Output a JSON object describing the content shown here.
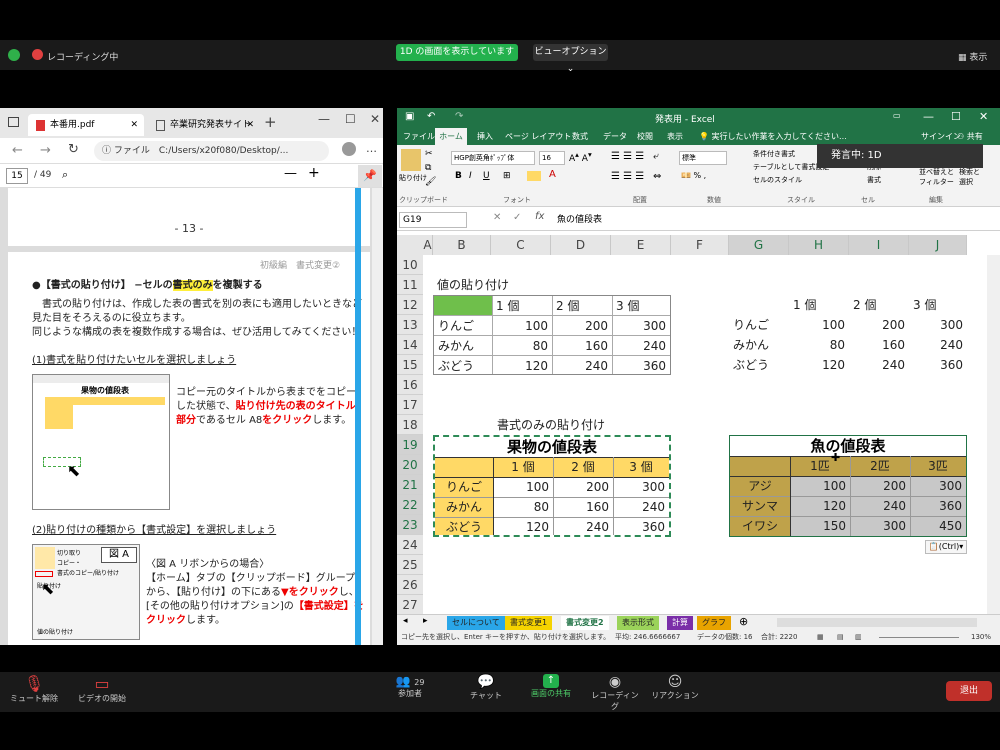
{
  "zoom_top": {
    "recording": "レコーディング中",
    "share_status": "1D の画面を表示しています",
    "view_options": "ビューオプション ⌄",
    "display": "表示"
  },
  "pdf": {
    "tabs": [
      "本番用.pdf",
      "卒業研究発表サイト"
    ],
    "address": "ファイル　C:/Users/x20f080/Desktop/...",
    "page_current": "15",
    "page_total": "/ 49",
    "page_number": "- 13 -",
    "header_right": "初級編　書式変更②",
    "heading_pre": "●【書式の貼り付け】 −セルの",
    "heading_hl": "書式のみ",
    "heading_post": "を複製する",
    "para1": "　書式の貼り付けは、作成した表の書式を別の表にも適用したいときなど見た目をそろえるのに役立ちます。",
    "para2": "同じような構成の表を複数作成する場合は、ぜひ活用してみてください！",
    "step1": "(1)書式を貼り付けたいセルを選択しましょう",
    "s1a": "コピー元のタイトルから表までをコピーした状態で、",
    "s1b": "貼り付け先の表のタイトル部分",
    "s1c": "であるセル A8",
    "s1d": "をクリック",
    "s1e": "します。",
    "step2": "(2)貼り付けの種類から【書式設定】を選択しましょう",
    "fig_label": "図 A",
    "s2a": "〈図 A  リボンからの場合〉",
    "s2b": "【ホーム】タブの【クリップボード】グループから、【貼り付け】の下にある",
    "s2c": "▼をクリック",
    "s2d": "し、",
    "s2e": "[その他の貼り付けオプション]の",
    "s2f": "【書式設定】をクリック",
    "s2g": "します。",
    "thumb_title": "果物の値段表",
    "thumb_menu": [
      "切り取り",
      "コピー・",
      "書式のコピー/貼り付け"
    ],
    "thumb_paste": "貼り付け",
    "thumb_valpaste": "値の貼り付け"
  },
  "excel": {
    "title": "発表用 - Excel",
    "menu": [
      "ファイル",
      "ホーム",
      "挿入",
      "ページ レイアウト",
      "数式",
      "データ",
      "校閲",
      "表示"
    ],
    "tell_me": "実行したい作業を入力してください...",
    "signin": "サインイン",
    "share": "共有",
    "speaking": "発言中: 1D",
    "font": "HGP創英角ﾎﾟｯﾌﾟ体",
    "font_size": "16",
    "number_format": "標準",
    "groups": [
      "クリップボード",
      "フォント",
      "配置",
      "数値",
      "スタイル",
      "セル",
      "編集"
    ],
    "styles": [
      "条件付き書式",
      "テーブルとして書式設定",
      "セルのスタイル"
    ],
    "cells_grp": [
      "挿入",
      "削除",
      "書式"
    ],
    "edit_grp": [
      "並べ替えと",
      "フィルター",
      "検索と",
      "選択"
    ],
    "paste_label": "貼り付け",
    "name_box": "G19",
    "formula": "魚の値段表",
    "columns": [
      "A",
      "B",
      "C",
      "D",
      "E",
      "F",
      "G",
      "H",
      "I",
      "J"
    ],
    "rows": [
      "10",
      "11",
      "12",
      "13",
      "14",
      "15",
      "16",
      "17",
      "18",
      "19",
      "20",
      "21",
      "22",
      "23",
      "24",
      "25",
      "26",
      "27"
    ],
    "value_paste_title": "値の貼り付け",
    "format_only_title": "書式のみの貼り付け",
    "table1": {
      "headers": [
        "1 個",
        "2 個",
        "3 個"
      ],
      "rows": [
        [
          "りんご",
          "100",
          "200",
          "300"
        ],
        [
          "みかん",
          "80",
          "160",
          "240"
        ],
        [
          "ぶどう",
          "120",
          "240",
          "360"
        ]
      ]
    },
    "table2": {
      "headers": [
        "1 個",
        "2 個",
        "3 個"
      ],
      "rows": [
        [
          "りんご",
          "100",
          "200",
          "300"
        ],
        [
          "みかん",
          "80",
          "160",
          "240"
        ],
        [
          "ぶどう",
          "120",
          "240",
          "360"
        ]
      ]
    },
    "table3": {
      "title": "果物の値段表",
      "headers": [
        "1 個",
        "2 個",
        "3 個"
      ],
      "rows": [
        [
          "りんご",
          "100",
          "200",
          "300"
        ],
        [
          "みかん",
          "80",
          "160",
          "240"
        ],
        [
          "ぶどう",
          "120",
          "240",
          "360"
        ]
      ]
    },
    "table4": {
      "title": "魚の値段表",
      "headers": [
        "1匹",
        "2匹",
        "3匹"
      ],
      "rows": [
        [
          "アジ",
          "100",
          "200",
          "300"
        ],
        [
          "サンマ",
          "120",
          "240",
          "360"
        ],
        [
          "イワシ",
          "150",
          "300",
          "450"
        ]
      ]
    },
    "ctrl_badge": "(Ctrl)",
    "sheets": [
      "セルについて",
      "書式変更1",
      "書式変更2",
      "表示形式",
      "計算",
      "グラフ"
    ],
    "status_left": "コピー先を選択し、Enter キーを押すか、貼り付けを選択します。",
    "status_avg": "平均: 246.6666667",
    "status_count": "データの個数: 16",
    "status_sum": "合計: 2220",
    "zoom_level": "130%"
  },
  "zoom_bottom": {
    "mute": "ミュート解除",
    "video": "ビデオの開始",
    "participants": "参加者",
    "participant_count": "29",
    "chat": "チャット",
    "share": "画面の共有",
    "record": "レコーディング",
    "reaction": "リアクション",
    "leave": "退出"
  }
}
